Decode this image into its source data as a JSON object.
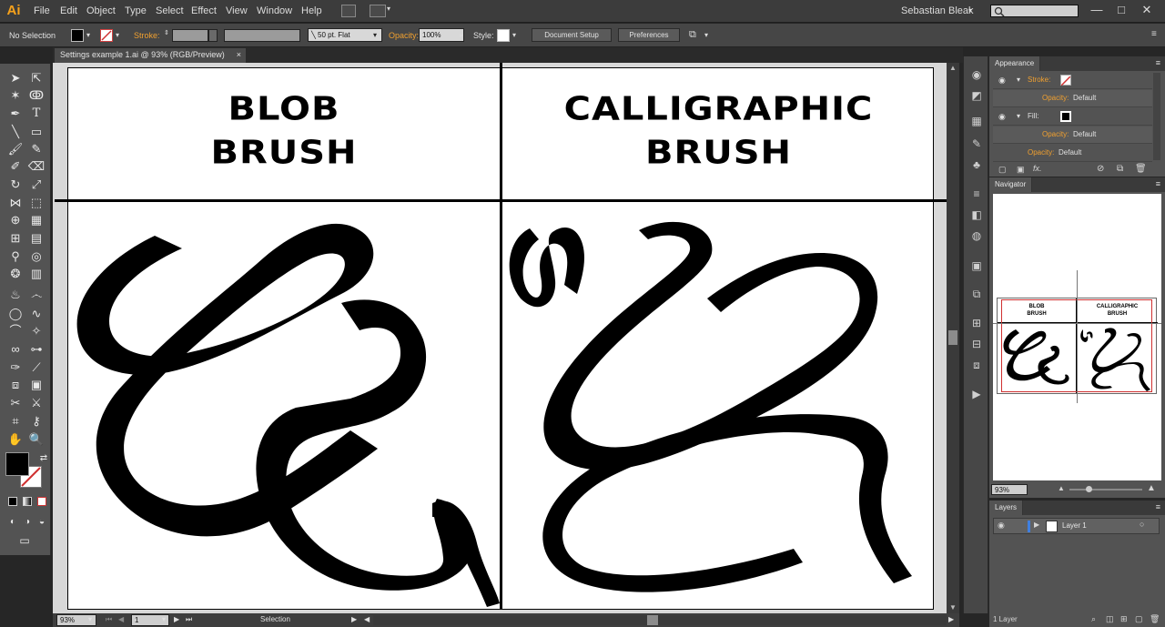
{
  "menubar": {
    "logo": "Ai",
    "items": [
      "File",
      "Edit",
      "Object",
      "Type",
      "Select",
      "Effect",
      "View",
      "Window",
      "Help"
    ],
    "user": "Sebastian Bleak",
    "user_caret": "▾",
    "window_controls": [
      "—",
      "□",
      "✕"
    ]
  },
  "controlbar": {
    "selection_label": "No Selection",
    "stroke_label": "Stroke:",
    "brush_value": "50 pt. Flat",
    "opacity_label": "Opacity:",
    "opacity_value": "100%",
    "style_label": "Style:",
    "document_setup_label": "Document Setup",
    "preferences_label": "Preferences"
  },
  "document": {
    "tab_title": "Settings example 1.ai @ 93% (RGB/Preview)",
    "tab_close": "×"
  },
  "artboard": {
    "left_heading_line1": "BLOB",
    "left_heading_line2": "BRUSH",
    "right_heading_line1": "CALLIGRAPHIC",
    "right_heading_line2": "BRUSH"
  },
  "statusbar": {
    "zoom_value": "93%",
    "artboard_number": "1",
    "tool_name": "Selection"
  },
  "appearance_panel": {
    "tab_label": "Appearance",
    "stroke_label": "Stroke:",
    "stroke_opacity_label": "Opacity:",
    "stroke_opacity_value": "Default",
    "fill_label": "Fill:",
    "fill_opacity_label": "Opacity:",
    "fill_opacity_value": "Default",
    "opacity_label": "Opacity:",
    "opacity_value": "Default",
    "fx_label": "fx."
  },
  "navigator_panel": {
    "tab_label": "Navigator",
    "zoom_value": "93%",
    "thumb_left_line1": "BLOB",
    "thumb_left_line2": "BRUSH",
    "thumb_right_line1": "CALLIGRAPHIC",
    "thumb_right_line2": "BRUSH"
  },
  "layers_panel": {
    "tab_label": "Layers",
    "layer_name": "Layer 1",
    "layer_count": "1 Layer"
  },
  "colors": {
    "accent_orange": "#f0a030",
    "navigator_red": "#d03030",
    "layer_blue": "#3f7fe0"
  }
}
